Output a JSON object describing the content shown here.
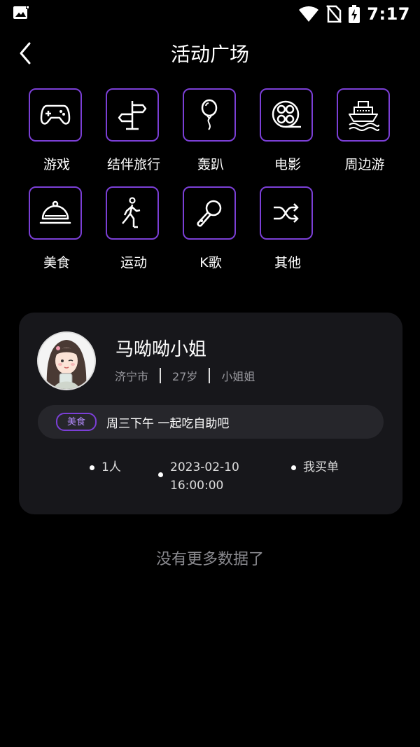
{
  "status": {
    "time": "7:17"
  },
  "header": {
    "title": "活动广场"
  },
  "categories": [
    {
      "label": "游戏",
      "icon": "gamepad-icon"
    },
    {
      "label": "结伴旅行",
      "icon": "signpost-icon"
    },
    {
      "label": "轰趴",
      "icon": "balloon-icon"
    },
    {
      "label": "电影",
      "icon": "film-reel-icon"
    },
    {
      "label": "周边游",
      "icon": "ship-icon"
    },
    {
      "label": "美食",
      "icon": "food-cloche-icon"
    },
    {
      "label": "运动",
      "icon": "walking-person-icon"
    },
    {
      "label": "K歌",
      "icon": "microphone-icon"
    },
    {
      "label": "其他",
      "icon": "shuffle-icon"
    }
  ],
  "activity": {
    "user_name": "马呦呦小姐",
    "city": "济宁市",
    "age": "27岁",
    "role": "小姐姐",
    "tag": "美食",
    "description": "周三下午 一起吃自助吧",
    "people": "1人",
    "date": "2023-02-10",
    "time": "16:00:00",
    "payment": "我买单"
  },
  "footer": {
    "no_more": "没有更多数据了"
  },
  "colors": {
    "accent": "#7b3fd6",
    "card_bg": "#17171b",
    "tag_text": "#b58cff"
  }
}
